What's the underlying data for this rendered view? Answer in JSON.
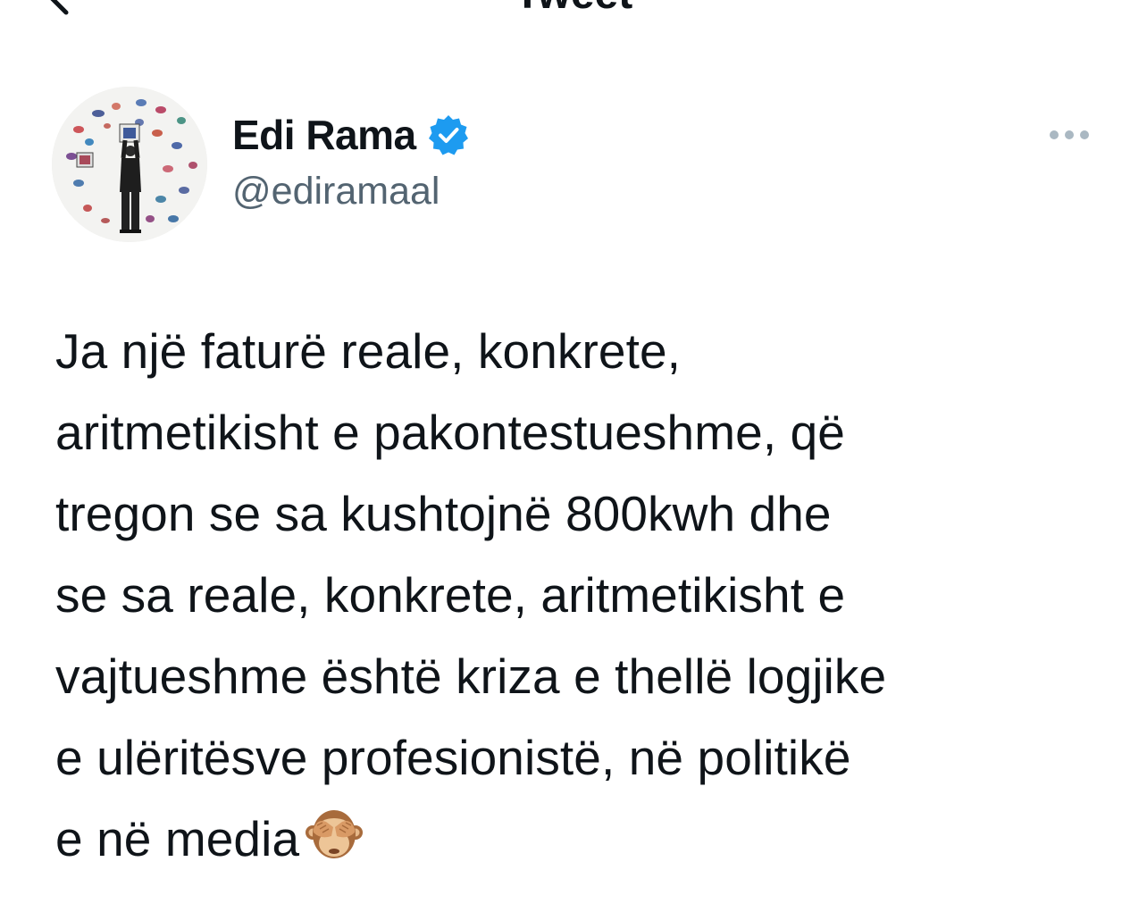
{
  "header": {
    "title": "Tweet",
    "back_icon": "chevron-left-icon"
  },
  "author": {
    "display_name": "Edi Rama",
    "handle": "@ediramaal",
    "verified": true,
    "verified_icon": "verified-badge-icon",
    "avatar_icon": "avatar-photo",
    "more_icon": "more-dots-icon"
  },
  "tweet": {
    "lines": [
      "Ja një faturë reale, konkrete,",
      "aritmetikisht e pakontestueshme, që",
      "tregon se sa kushtojnë 800kwh dhe",
      "se sa reale, konkrete, aritmetikisht e",
      "vajtueshme është kriza e thellë logjike",
      "e ulëritësve profesionistë, në politikë",
      "e në media"
    ],
    "emoji": "see-no-evil-monkey-emoji"
  },
  "colors": {
    "text": "#0f1419",
    "secondary": "#536471",
    "verified": "#1d9bf0",
    "background": "#ffffff"
  }
}
